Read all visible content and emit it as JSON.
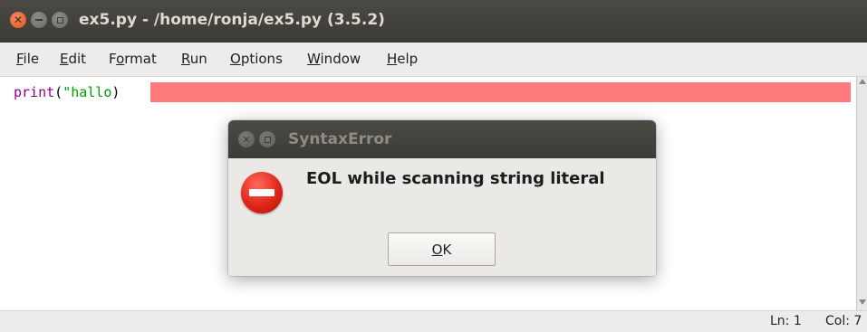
{
  "window": {
    "title": "ex5.py - /home/ronja/ex5.py (3.5.2)"
  },
  "menu": {
    "items": [
      {
        "first": "F",
        "rest": "ile"
      },
      {
        "first": "E",
        "rest": "dit"
      },
      {
        "pre": "F",
        "first": "o",
        "rest": "rmat"
      },
      {
        "first": "R",
        "rest": "un"
      },
      {
        "first": "O",
        "rest": "ptions"
      },
      {
        "first": "W",
        "rest": "indow"
      },
      {
        "first": "H",
        "rest": "elp"
      }
    ]
  },
  "editor": {
    "code_keyword": "print",
    "code_open": "(",
    "code_string": "\"hallo",
    "code_close": ")",
    "error_highlight_color": "#ff7b7b"
  },
  "status": {
    "line": "Ln: 1",
    "col": "Col: 7"
  },
  "dialog": {
    "title": "SyntaxError",
    "message": "EOL while scanning string literal",
    "ok_first": "O",
    "ok_rest": "K",
    "icon": "error-icon"
  }
}
